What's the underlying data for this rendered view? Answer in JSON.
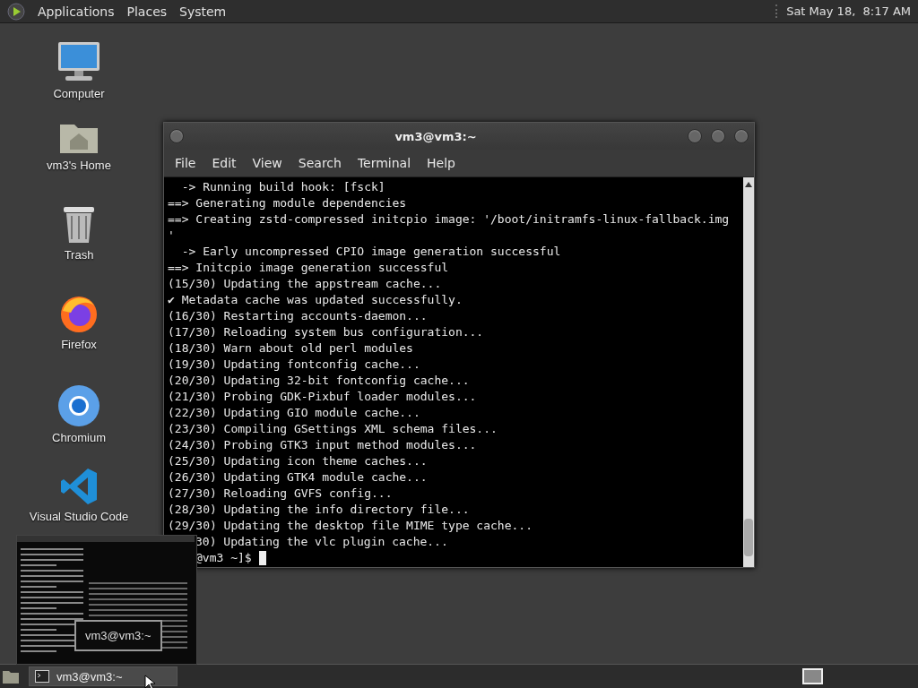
{
  "top_panel": {
    "menus": [
      {
        "label": "Applications"
      },
      {
        "label": "Places"
      },
      {
        "label": "System"
      }
    ],
    "clock": "Sat May 18,  8:17 AM"
  },
  "desktop_icons": [
    {
      "label": "Computer",
      "kind": "computer"
    },
    {
      "label": "vm3's Home",
      "kind": "home"
    },
    {
      "label": "Trash",
      "kind": "trash"
    },
    {
      "label": "Firefox",
      "kind": "firefox"
    },
    {
      "label": "Chromium",
      "kind": "chromium"
    },
    {
      "label": "Visual Studio Code",
      "kind": "vscode"
    }
  ],
  "window": {
    "title": "vm3@vm3:~",
    "menus": [
      {
        "label": "File"
      },
      {
        "label": "Edit"
      },
      {
        "label": "View"
      },
      {
        "label": "Search"
      },
      {
        "label": "Terminal"
      },
      {
        "label": "Help"
      }
    ],
    "lines": [
      {
        "text": "  -> Running build hook: [fsck]",
        "kind": "line"
      },
      {
        "text": "==> Generating module dependencies",
        "kind": "line"
      },
      {
        "text": "==> Creating zstd-compressed initcpio image: '/boot/initramfs-linux-fallback.img",
        "kind": "line"
      },
      {
        "text": "'",
        "kind": "line"
      },
      {
        "text": "  -> Early uncompressed CPIO image generation successful",
        "kind": "line"
      },
      {
        "text": "==> Initcpio image generation successful",
        "kind": "line"
      },
      {
        "text": "(15/30) Updating the appstream cache...",
        "kind": "line"
      },
      {
        "text": "✔ Metadata cache was updated successfully.",
        "kind": "line"
      },
      {
        "text": "(16/30) Restarting accounts-daemon...",
        "kind": "line"
      },
      {
        "text": "(17/30) Reloading system bus configuration...",
        "kind": "line"
      },
      {
        "text": "(18/30) Warn about old perl modules",
        "kind": "line"
      },
      {
        "text": "(19/30) Updating fontconfig cache...",
        "kind": "line"
      },
      {
        "text": "(20/30) Updating 32-bit fontconfig cache...",
        "kind": "line"
      },
      {
        "text": "(21/30) Probing GDK-Pixbuf loader modules...",
        "kind": "line"
      },
      {
        "text": "(22/30) Updating GIO module cache...",
        "kind": "line"
      },
      {
        "text": "(23/30) Compiling GSettings XML schema files...",
        "kind": "line"
      },
      {
        "text": "(24/30) Probing GTK3 input method modules...",
        "kind": "line"
      },
      {
        "text": "(25/30) Updating icon theme caches...",
        "kind": "line"
      },
      {
        "text": "(26/30) Updating GTK4 module cache...",
        "kind": "line"
      },
      {
        "text": "(27/30) Reloading GVFS config...",
        "kind": "line"
      },
      {
        "text": "(28/30) Updating the info directory file...",
        "kind": "line"
      },
      {
        "text": "(29/30) Updating the desktop file MIME type cache...",
        "kind": "line"
      },
      {
        "text": "30) Updating the vlc plugin cache...",
        "kind": "covered"
      },
      {
        "text": "@vm3 ~]$",
        "kind": "prompt"
      }
    ]
  },
  "preview": {
    "label": "vm3@vm3:~"
  },
  "taskbar": {
    "tasks": [
      {
        "label": "vm3@vm3:~",
        "selected": true
      }
    ]
  }
}
